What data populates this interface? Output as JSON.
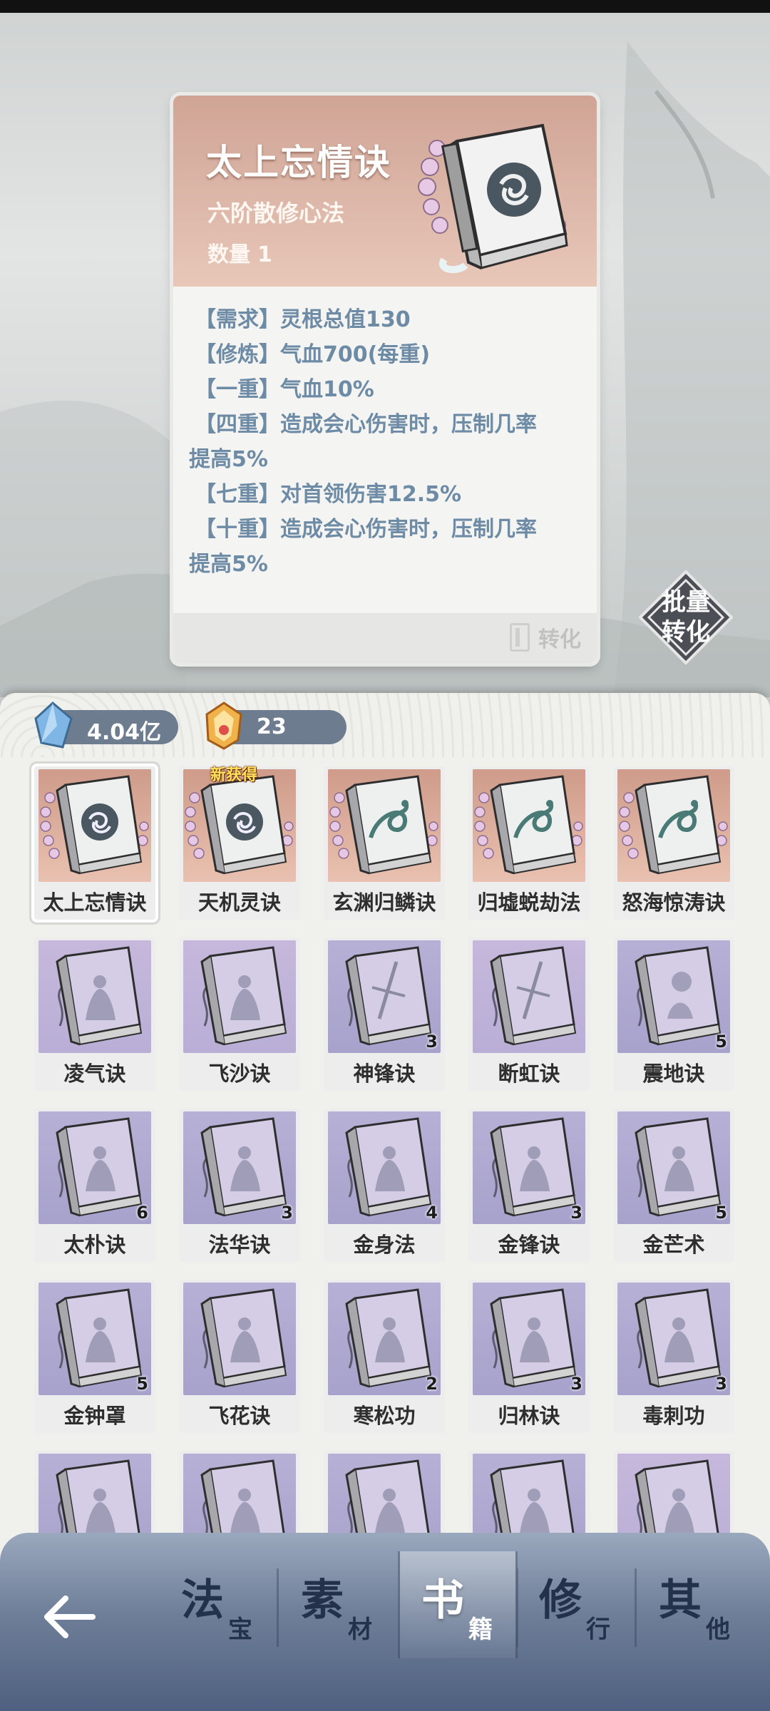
{
  "detail": {
    "title": "太上忘情诀",
    "subtitle": "六阶散修心法",
    "quantity_label": "数量",
    "quantity_value": "1",
    "lines": [
      "【需求】灵根总值130",
      "【修炼】气血700(每重)",
      "【一重】气血10%",
      "【四重】造成会心伤害时，压制几率",
      "提高5%",
      "【七重】对首领伤害12.5%",
      "【十重】造成会心伤害时，压制几率",
      "提高5%"
    ],
    "convert_label": "转化",
    "book_icon": "gold-book-icon"
  },
  "batch_convert": {
    "line1": "批量",
    "line2": "转化"
  },
  "currencies": [
    {
      "icon": "spirit-stone-icon",
      "value": "4.04亿",
      "color": "#7fb6e6"
    },
    {
      "icon": "gold-gem-icon",
      "value": "23",
      "color": "#f0b24a"
    }
  ],
  "items": [
    {
      "name": "太上忘情诀",
      "count": "",
      "art": "gold",
      "emblem": "swirl",
      "selected": true,
      "new": ""
    },
    {
      "name": "天机灵诀",
      "count": "",
      "art": "gold",
      "emblem": "swirl",
      "selected": false,
      "new": "新获得"
    },
    {
      "name": "玄渊归鳞诀",
      "count": "",
      "art": "gold",
      "emblem": "dragon",
      "selected": false,
      "new": ""
    },
    {
      "name": "归墟蜕劫法",
      "count": "",
      "art": "gold",
      "emblem": "dragon",
      "selected": false,
      "new": ""
    },
    {
      "name": "怒海惊涛诀",
      "count": "",
      "art": "gold",
      "emblem": "dragon",
      "selected": false,
      "new": ""
    },
    {
      "name": "凌气诀",
      "count": "",
      "art": "purpleb",
      "emblem": "figure",
      "selected": false,
      "new": ""
    },
    {
      "name": "飞沙诀",
      "count": "",
      "art": "purpleb",
      "emblem": "figure",
      "selected": false,
      "new": ""
    },
    {
      "name": "神锋诀",
      "count": "3",
      "art": "purple",
      "emblem": "sword",
      "selected": false,
      "new": ""
    },
    {
      "name": "断虹诀",
      "count": "",
      "art": "purpleb",
      "emblem": "sword",
      "selected": false,
      "new": ""
    },
    {
      "name": "震地诀",
      "count": "5",
      "art": "purple",
      "emblem": "orb",
      "selected": false,
      "new": ""
    },
    {
      "name": "太朴诀",
      "count": "6",
      "art": "purple",
      "emblem": "figure",
      "selected": false,
      "new": ""
    },
    {
      "name": "法华诀",
      "count": "3",
      "art": "purple",
      "emblem": "figure",
      "selected": false,
      "new": ""
    },
    {
      "name": "金身法",
      "count": "4",
      "art": "purple",
      "emblem": "figure",
      "selected": false,
      "new": ""
    },
    {
      "name": "金锋诀",
      "count": "3",
      "art": "purple",
      "emblem": "figure",
      "selected": false,
      "new": ""
    },
    {
      "name": "金芒术",
      "count": "5",
      "art": "purple",
      "emblem": "figure",
      "selected": false,
      "new": ""
    },
    {
      "name": "金钟罩",
      "count": "5",
      "art": "purple",
      "emblem": "figure",
      "selected": false,
      "new": ""
    },
    {
      "name": "飞花诀",
      "count": "",
      "art": "purple",
      "emblem": "figure",
      "selected": false,
      "new": ""
    },
    {
      "name": "寒松功",
      "count": "2",
      "art": "purple",
      "emblem": "figure",
      "selected": false,
      "new": ""
    },
    {
      "name": "归林诀",
      "count": "3",
      "art": "purple",
      "emblem": "figure",
      "selected": false,
      "new": ""
    },
    {
      "name": "毒刺功",
      "count": "3",
      "art": "purple",
      "emblem": "figure",
      "selected": false,
      "new": ""
    },
    {
      "name": "",
      "count": "",
      "art": "purple",
      "emblem": "figure",
      "selected": false,
      "new": ""
    },
    {
      "name": "",
      "count": "",
      "art": "purple",
      "emblem": "figure",
      "selected": false,
      "new": ""
    },
    {
      "name": "",
      "count": "",
      "art": "purple",
      "emblem": "figure",
      "selected": false,
      "new": ""
    },
    {
      "name": "",
      "count": "",
      "art": "purple",
      "emblem": "figure",
      "selected": false,
      "new": ""
    },
    {
      "name": "",
      "count": "",
      "art": "purpleb",
      "emblem": "figure",
      "selected": false,
      "new": ""
    }
  ],
  "nav": {
    "back_icon": "back-arrow-icon",
    "tabs": [
      {
        "main": "法",
        "sub": "宝",
        "active": false
      },
      {
        "main": "素",
        "sub": "材",
        "active": false
      },
      {
        "main": "书",
        "sub": "籍",
        "active": true
      },
      {
        "main": "修",
        "sub": "行",
        "active": false
      },
      {
        "main": "其",
        "sub": "他",
        "active": false
      }
    ]
  }
}
